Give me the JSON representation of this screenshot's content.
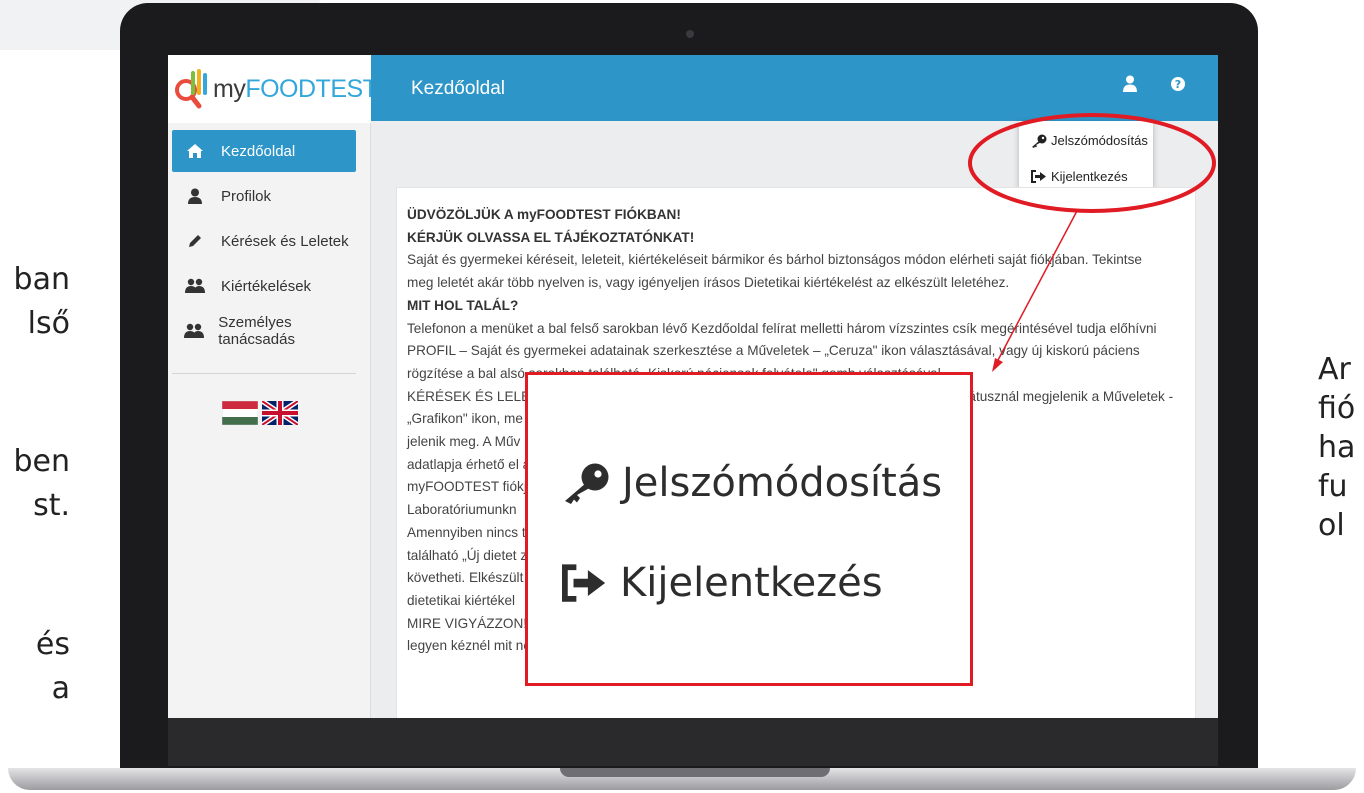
{
  "side_text_left": [
    "ban",
    "lső",
    "",
    "ben",
    "st.",
    "",
    "és",
    "a"
  ],
  "side_text_right": [
    "Ar",
    "fió",
    "ha",
    "fu",
    "ol"
  ],
  "logo": {
    "my": "my",
    "food": "FOODTEST"
  },
  "header": {
    "title": "Kezdőoldal"
  },
  "sidebar": {
    "items": [
      {
        "label": "Kezdőoldal",
        "icon": "home-icon",
        "active": true
      },
      {
        "label": "Profilok",
        "icon": "user-icon",
        "active": false
      },
      {
        "label": "Kérések és Leletek",
        "icon": "pencil-icon",
        "active": false
      },
      {
        "label": "Kiértékelések",
        "icon": "users-icon",
        "active": false
      },
      {
        "label": "Személyes tanácsadás",
        "icon": "users-icon",
        "active": false
      }
    ],
    "flags": [
      "hungarian-flag-icon",
      "uk-flag-icon"
    ]
  },
  "user_menu": {
    "items": [
      {
        "label": "Jelszómódosítás",
        "icon": "key-icon"
      },
      {
        "label": "Kijelentkezés",
        "icon": "sign-out-icon"
      }
    ]
  },
  "content": {
    "lines": [
      "ÜDVÖZÖLJÜK A myFOODTEST FIÓKBAN!",
      "KÉRJÜK OLVASSA EL TÁJÉKOZTATÓNKAT!",
      "Saját és gyermekei kéréseit, leleteit, kiértékeléseit bármikor és bárhol biztonságos módon elérheti saját fiókjában. Tekintse",
      "meg leletét akár több nyelven is, vagy igényeljen írásos Dietetikai kiértékelést az elkészült leletéhez.",
      "MIT HOL TALÁL?",
      "Telefonon a menüket a bal felső sarokban lévő Kezdőoldal felírat melletti három vízszintes csík megérintésével tudja előhívni",
      "PROFIL – Saját és gyermekei adatainak szerkesztése a Műveletek – „Ceruza\" ikon választásával, vagy új kiskorú páciens",
      "rögzítése a bal alsó sarokban található „Kiskorú páciensek felvétele\" gomb választásával.",
      "KÉRÉSEK ÉS LELETEK – Kérés státuszát folyamatosan nyomon követheti. Lelet elkészült státusznál megjelenik a Műveletek -",
      "„Grafikon\" ikon, me                                                                                                        elő és a lelete PDF formában",
      "jelenik meg. A Műv                                                                                                     rhető kiértékelés igénylő",
      "adatlapja érhető el                                                                                                    átadta a futárnak lépjen be",
      "myFOODTEST fiókj                                                                                                       autó\" ikont. Ezzel tudja jelezni",
      "Laboratóriumunkn",
      "Amennyiben nincs                                                                                                      tlapját a bal alsó sarokban",
      "található „Új dietet                                                                                                     zát folyamatosan nyomon",
      "követheti. Elkészült                                                                                                     DF formában töltheti le",
      "dietetikai kiértékel",
      "MIRE VIGYÁZZON!                                                                                                      ítséget! Bármely pillanatban",
      "legyen kéznél mit nem ehet, mire kell vigyáznia, akár vásárláskor, akár egy étteremben."
    ]
  },
  "zoom": {
    "items": [
      {
        "label": "Jelszómódosítás",
        "icon": "key-icon"
      },
      {
        "label": "Kijelentkezés",
        "icon": "sign-out-icon"
      }
    ]
  },
  "colors": {
    "primary": "#2e95c9",
    "highlight": "#e01b24",
    "brand_blue": "#33a7da"
  }
}
